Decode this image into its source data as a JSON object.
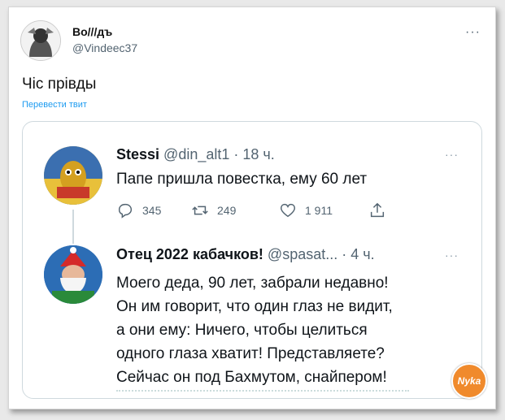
{
  "tweet": {
    "author_name": "Во///дъ",
    "author_handle": "@Vindeec37",
    "text": "Чіс прівды",
    "translate_link": "Перевести твит",
    "more_label": "···"
  },
  "quoted": {
    "first": {
      "name": "Stessi",
      "meta": " @din_alt1 · 18 ч.",
      "text": "Папе пришла повестка, ему 60 лет",
      "replies": "345",
      "retweets": "249",
      "likes": "1 911"
    },
    "second": {
      "name": "Отец 2022 кабачков!",
      "meta": " @spasat... · 4 ч.",
      "lines": [
        "Моего деда, 90 лет, забрали недавно!",
        "Он им говорит,  что один глаз не видит,",
        "а они ему: Ничего,  чтобы целиться",
        "одного глаза хватит! Представляете?",
        "Сейчас он под Бахмутом, снайпером!"
      ]
    },
    "more_label": "···"
  },
  "watermark": {
    "text": "Nyka"
  },
  "colors": {
    "link": "#1d9bf0",
    "secondary": "#536471",
    "watermark": "#f08a2c"
  }
}
